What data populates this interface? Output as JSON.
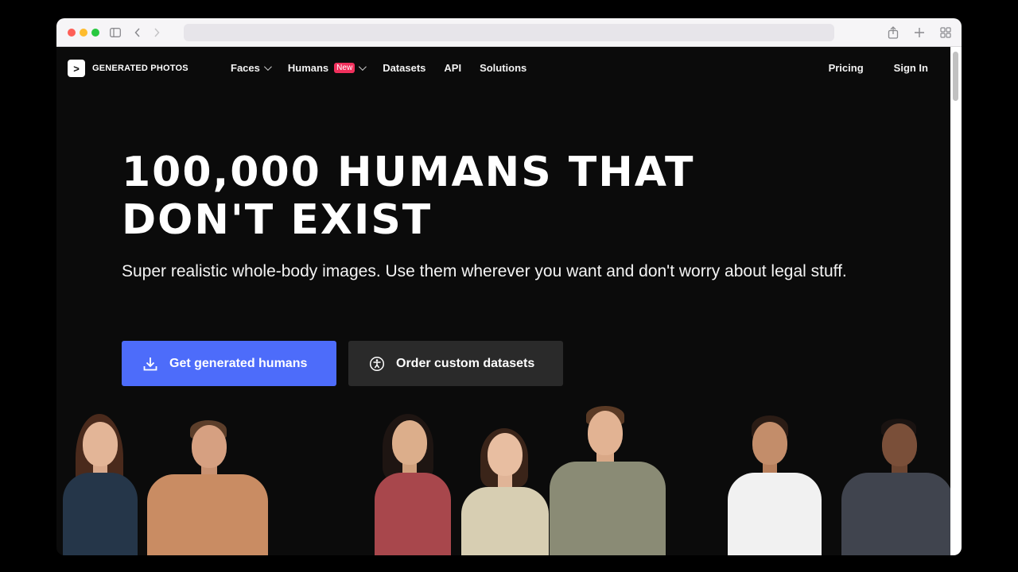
{
  "brand": {
    "name": "GENERATED PHOTOS",
    "logo_glyph": ">"
  },
  "nav": {
    "items": [
      {
        "label": "Faces",
        "has_dropdown": true
      },
      {
        "label": "Humans",
        "badge": "New",
        "has_dropdown": true
      },
      {
        "label": "Datasets"
      },
      {
        "label": "API"
      },
      {
        "label": "Solutions"
      }
    ],
    "right": [
      {
        "label": "Pricing"
      },
      {
        "label": "Sign In"
      }
    ]
  },
  "hero": {
    "title_line1": "100,000 Humans that",
    "title_line2": "don't exist",
    "subtitle": "Super realistic whole-body images. Use them wherever you want and don't worry about legal stuff.",
    "primary_cta": "Get generated humans",
    "secondary_cta": "Order custom datasets"
  },
  "colors": {
    "background": "#0b0b0b",
    "primary": "#4d6cfa",
    "secondary": "#2a2a2a",
    "badge": "#f0305c"
  },
  "icons": {
    "primary_cta": "download-icon",
    "secondary_cta": "accessibility-icon"
  }
}
